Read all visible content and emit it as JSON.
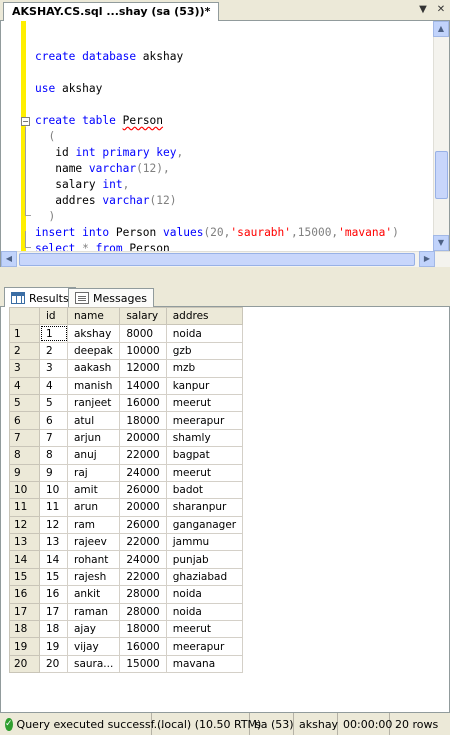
{
  "document_tab": {
    "title": "AKSHAY.CS.sql ...shay (sa (53))*"
  },
  "editor": {
    "lines": {
      "l1": {
        "kw1": "create",
        "kw2": "database",
        "txt": " akshay"
      },
      "l2": {
        "kw1": "use",
        "txt": " akshay"
      },
      "l3": {
        "kw1": "create",
        "kw2": "table",
        "txt": "Person"
      },
      "l4": {
        "txt": "("
      },
      "l5": {
        "txt": "id ",
        "kw1": "int",
        "kw2": "primary key",
        "p": ","
      },
      "l6": {
        "txt": "name ",
        "kw1": "varchar",
        "p": "(12),"
      },
      "l7": {
        "txt": "salary ",
        "kw1": "int",
        "p": ","
      },
      "l8": {
        "txt": "addres ",
        "kw1": "varchar",
        "p": "(12)"
      },
      "l9": {
        "txt": ")"
      },
      "l10": {
        "kw1": "insert",
        "kw2": "into",
        "txt": " Person ",
        "kw3": "values",
        "p1": "(20,",
        "s1": "'saurabh'",
        "p2": ",15000,",
        "s2": "'mavana'",
        "p3": ")"
      },
      "l11": {
        "kw1": "select",
        "p": " * ",
        "kw2": "from",
        "txt": " Person"
      }
    }
  },
  "result_tabs": {
    "results": "Results",
    "messages": "Messages"
  },
  "grid": {
    "columns": [
      "id",
      "name",
      "salary",
      "addres"
    ],
    "rows": [
      {
        "n": "1",
        "id": "1",
        "name": "akshay",
        "salary": "8000",
        "addres": "noida"
      },
      {
        "n": "2",
        "id": "2",
        "name": "deepak",
        "salary": "10000",
        "addres": "gzb"
      },
      {
        "n": "3",
        "id": "3",
        "name": "aakash",
        "salary": "12000",
        "addres": "mzb"
      },
      {
        "n": "4",
        "id": "4",
        "name": "manish",
        "salary": "14000",
        "addres": "kanpur"
      },
      {
        "n": "5",
        "id": "5",
        "name": "ranjeet",
        "salary": "16000",
        "addres": "meerut"
      },
      {
        "n": "6",
        "id": "6",
        "name": "atul",
        "salary": "18000",
        "addres": "meerapur"
      },
      {
        "n": "7",
        "id": "7",
        "name": "arjun",
        "salary": "20000",
        "addres": "shamly"
      },
      {
        "n": "8",
        "id": "8",
        "name": "anuj",
        "salary": "22000",
        "addres": "bagpat"
      },
      {
        "n": "9",
        "id": "9",
        "name": "raj",
        "salary": "24000",
        "addres": "meerut"
      },
      {
        "n": "10",
        "id": "10",
        "name": "amit",
        "salary": "26000",
        "addres": "badot"
      },
      {
        "n": "11",
        "id": "11",
        "name": "arun",
        "salary": "20000",
        "addres": "sharanpur"
      },
      {
        "n": "12",
        "id": "12",
        "name": "ram",
        "salary": "26000",
        "addres": "ganganager"
      },
      {
        "n": "13",
        "id": "13",
        "name": "rajeev",
        "salary": "22000",
        "addres": "jammu"
      },
      {
        "n": "14",
        "id": "14",
        "name": "rohant",
        "salary": "24000",
        "addres": "punjab"
      },
      {
        "n": "15",
        "id": "15",
        "name": "rajesh",
        "salary": "22000",
        "addres": "ghaziabad"
      },
      {
        "n": "16",
        "id": "16",
        "name": "ankit",
        "salary": "28000",
        "addres": "noida"
      },
      {
        "n": "17",
        "id": "17",
        "name": "raman",
        "salary": "28000",
        "addres": "noida"
      },
      {
        "n": "18",
        "id": "18",
        "name": "ajay",
        "salary": "18000",
        "addres": "meerut"
      },
      {
        "n": "19",
        "id": "19",
        "name": "vijay",
        "salary": "16000",
        "addres": "meerapur"
      },
      {
        "n": "20",
        "id": "20",
        "name": "saura...",
        "salary": "15000",
        "addres": "mavana"
      }
    ]
  },
  "status_bar": {
    "message": "Query executed successf...",
    "server": "(local) (10.50 RTM)",
    "login": "sa (53)",
    "database": "akshay",
    "elapsed": "00:00:00",
    "rows": "20 rows"
  },
  "colors": {
    "keyword": "#0000ff",
    "string": "#ff0000",
    "change_bar": "#ffef00",
    "success": "#2f9e2f"
  }
}
